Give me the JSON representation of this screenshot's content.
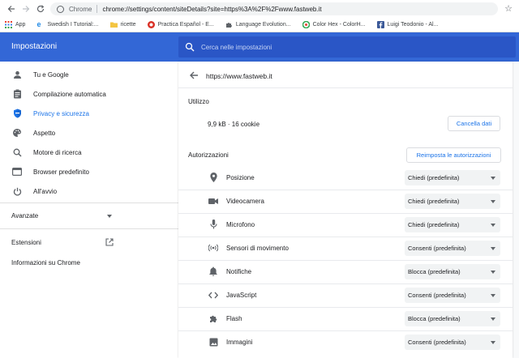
{
  "browser": {
    "chip": "Chrome",
    "url": "chrome://settings/content/siteDetails?site=https%3A%2F%2Fwww.fastweb.it"
  },
  "bookmarks": [
    {
      "label": "App",
      "icon": "apps-grid-icon",
      "color": "#4285f4"
    },
    {
      "label": "Swedish I Tutorial:...",
      "icon": "ie-icon",
      "color": "#1e88e5"
    },
    {
      "label": "ricette",
      "icon": "folder-icon",
      "color": "#f4c542"
    },
    {
      "label": "Practica Español - E...",
      "icon": "practica-icon",
      "color": "#d93025"
    },
    {
      "label": "Language Evolution...",
      "icon": "puzzle-icon",
      "color": "#5f6368"
    },
    {
      "label": "Color Hex - ColorH...",
      "icon": "colorhex-icon",
      "color": "#34a853"
    },
    {
      "label": "Luigi Teodonio - Al...",
      "icon": "facebook-icon",
      "color": "#3b5998"
    }
  ],
  "header": {
    "title": "Impostazioni",
    "search_placeholder": "Cerca nelle impostazioni",
    "color": "#3367d6"
  },
  "sidebar": {
    "items": [
      {
        "label": "Tu e Google",
        "icon": "person-icon"
      },
      {
        "label": "Compilazione automatica",
        "icon": "clipboard-icon"
      },
      {
        "label": "Privacy e sicurezza",
        "icon": "shield-icon",
        "active": true
      },
      {
        "label": "Aspetto",
        "icon": "palette-icon"
      },
      {
        "label": "Motore di ricerca",
        "icon": "search-icon"
      },
      {
        "label": "Browser predefinito",
        "icon": "browser-icon"
      },
      {
        "label": "All'avvio",
        "icon": "power-icon"
      }
    ],
    "advanced": "Avanzate",
    "extensions": "Estensioni",
    "about": "Informazioni su Chrome"
  },
  "site": {
    "title": "https://www.fastweb.it",
    "usage_heading": "Utilizzo",
    "usage_value": "9,9 kB · 16 cookie",
    "clear_button": "Cancella dati",
    "permissions_heading": "Autorizzazioni",
    "reset_button": "Reimposta le autorizzazioni",
    "permissions": [
      {
        "label": "Posizione",
        "value": "Chiedi (predefinita)",
        "icon": "location-pin-icon"
      },
      {
        "label": "Videocamera",
        "value": "Chiedi (predefinita)",
        "icon": "videocam-icon"
      },
      {
        "label": "Microfono",
        "value": "Chiedi (predefinita)",
        "icon": "microphone-icon"
      },
      {
        "label": "Sensori di movimento",
        "value": "Consenti (predefinita)",
        "icon": "sensors-icon"
      },
      {
        "label": "Notifiche",
        "value": "Blocca (predefinita)",
        "icon": "bell-icon"
      },
      {
        "label": "JavaScript",
        "value": "Consenti (predefinita)",
        "icon": "code-icon"
      },
      {
        "label": "Flash",
        "value": "Blocca (predefinita)",
        "icon": "puzzle-icon"
      },
      {
        "label": "Immagini",
        "value": "Consenti (predefinita)",
        "icon": "image-icon"
      }
    ]
  },
  "colors": {
    "accent": "#1a73e8"
  }
}
